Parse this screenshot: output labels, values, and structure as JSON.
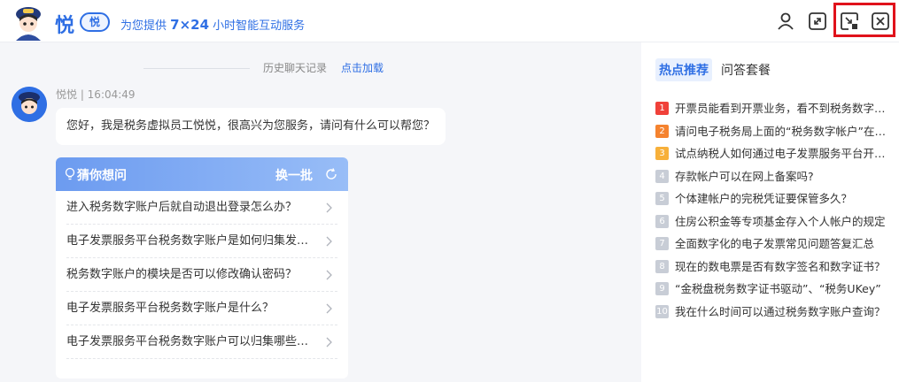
{
  "header": {
    "brand": "悦",
    "badge": "悦",
    "slogan_pre": "为您提供 ",
    "slogan_bold": "7×24",
    "slogan_post": " 小时智能互动服务",
    "buttons": [
      "user-icon",
      "expand-icon",
      "minimize-icon",
      "close-icon"
    ]
  },
  "chat": {
    "history_label": "历史聊天记录",
    "history_load": "点击加载",
    "sender_meta": "悦悦 | 16:04:49",
    "greeting": "您好，我是税务虚拟员工悦悦，很高兴为您服务，请问有什么可以帮您？",
    "guess": {
      "title": "猜你想问",
      "refresh": "换一批",
      "questions": [
        "进入税务数字账户后就自动退出登录怎么办？",
        "电子发票服务平台税务数字账户是如何归集发票的？",
        "税务数字账户的模块是否可以修改确认密码？",
        "电子发票服务平台税务数字账户是什么？",
        "电子发票服务平台税务数字账户可以归集哪些发票？"
      ]
    }
  },
  "side": {
    "tabs": [
      "热点推荐",
      "问答套餐"
    ],
    "hot": [
      {
        "n": "1",
        "text": "开票员能看到开票业务，看不到税务数字账户？"
      },
      {
        "n": "2",
        "text": "请问电子税务局上面的“税务数字帐户”在哪里？"
      },
      {
        "n": "3",
        "text": "试点纳税人如何通过电子发票服务平台开票？"
      },
      {
        "n": "4",
        "text": "存款帐户可以在网上备案吗?"
      },
      {
        "n": "5",
        "text": "个体建帐户的完税凭证要保管多久？"
      },
      {
        "n": "6",
        "text": "住房公积金等专项基金存入个人帐户的规定"
      },
      {
        "n": "7",
        "text": "全面数字化的电子发票常见问题答复汇总"
      },
      {
        "n": "8",
        "text": "现在的数电票是否有数字签名和数字证书？"
      },
      {
        "n": "9",
        "text": "“金税盘税务数字证书驱动”、“税务UKey”"
      },
      {
        "n": "10",
        "text": "我在什么时间可以通过税务数字账户查询？"
      }
    ],
    "num_colors": [
      "#f0413a",
      "#f5832f",
      "#f7b03a"
    ]
  }
}
